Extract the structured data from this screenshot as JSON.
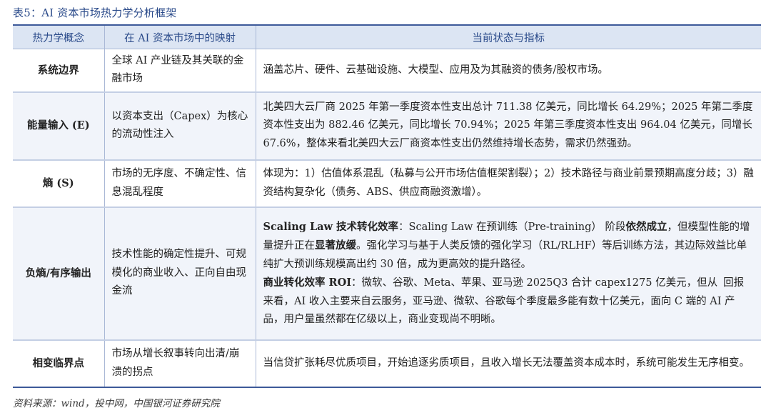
{
  "caption": "表5：AI 资本市场热力学分析框架",
  "headers": [
    "热力学概念",
    "在 AI 资本市场中的映射",
    "当前状态与指标"
  ],
  "rows": [
    {
      "concept": "系统边界",
      "mapping": "全球 AI 产业链及其关联的金融市场",
      "status": "涵盖芯片、硬件、云基础设施、大模型、应用及为其融资的债务/股权市场。"
    },
    {
      "concept": "能量输入 (E)",
      "mapping": "以资本支出（Capex）为核心的流动性注入",
      "status": "北美四大云厂商 2025 年第一季度资本性支出总计 711.38 亿美元，同比增长 64.29%；2025 年第二季度资本性支出为 882.46 亿美元，同比增长 70.94%；2025 年第三季度资本性支出 964.04 亿美元，同增长 67.6%，整体来看北美四大云厂商资本性支出仍然维持增长态势，需求仍然强劲。"
    },
    {
      "concept": "熵 (S)",
      "mapping": "市场的无序度、不确定性、信息混乱程度",
      "status": "体现为：1）估值体系混乱（私募与公开市场估值框架割裂）；2）技术路径与商业前景预期高度分歧；3）融资结构复杂化（债务、ABS、供应商融资激增）。"
    },
    {
      "concept": "负熵/有序输出",
      "mapping": "技术性能的确定性提升、可规模化的商业收入、正向自由现金流",
      "status": {
        "p1_head": "Scaling Law 技术转化效率",
        "p1_a": "：Scaling Law 在预训练（Pre-training） 阶段",
        "p1_b": "依然成立",
        "p1_c": "，但模型性能的增量提升正在",
        "p1_d": "显著放缓",
        "p1_e": "。强化学习与基于人类反馈的强化学习（RL/RLHF）等后训练方法，其边际效益比单纯扩大预训练规模高出约 30 倍，成为更高效的提升路径。",
        "p2_head": "商业转化效率 ROI",
        "p2_a": "：微软、谷歌、Meta、苹果、亚马逊 2025Q3 合计 capex1275 亿美元，但从",
        "p2_b": "回报来看，AI 收入主要来自云服务，亚马逊、微软、谷歌每个季度最多能有数十亿美元，面向 C 端的 AI 产品，用户量虽然都在亿级以上，商业变现尚不明晰。"
      }
    },
    {
      "concept": "相变临界点",
      "mapping": "市场从增长叙事转向出清/崩溃的拐点",
      "status": "当信贷扩张耗尽优质项目，开始追逐劣质项目，且收入增长无法覆盖资本成本时，系统可能发生无序相变。"
    }
  ],
  "source": "资料来源：wind，投中网，中国银河证券研究院",
  "colors": {
    "accent": "#3d5a99",
    "header_bg": "#dce5f3",
    "alt_row_bg": "#f1f4fa"
  }
}
